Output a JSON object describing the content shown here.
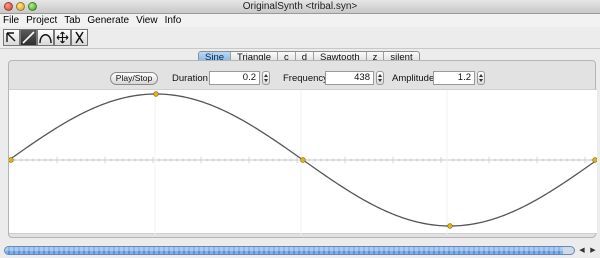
{
  "window": {
    "title": "OriginalSynth <tribal.syn>"
  },
  "menu": [
    "File",
    "Project",
    "Tab",
    "Generate",
    "View",
    "Info"
  ],
  "toolbar": {
    "tools": [
      {
        "name": "pointer-tool",
        "icon": "pointer-arrow-icon",
        "active": false
      },
      {
        "name": "line-tool",
        "icon": "diagonal-line-icon",
        "active": true
      },
      {
        "name": "curve-tool",
        "icon": "arc-curve-icon",
        "active": false
      },
      {
        "name": "move-tool",
        "icon": "four-way-arrows-icon",
        "active": false
      },
      {
        "name": "delete-tool",
        "icon": "scissor-x-icon",
        "active": false
      }
    ]
  },
  "tabs": [
    "Sine",
    "Triangle",
    "c",
    "d",
    "Sawtooth",
    "z",
    "silent"
  ],
  "selected_tab": "Sine",
  "controls": {
    "play_label": "Play/Stop",
    "duration_label": "Duration",
    "duration_value": "0.2",
    "frequency_label": "Frequency",
    "frequency_value": "438",
    "amplitude_label": "Amplitude",
    "amplitude_value": "1.2"
  },
  "waveform": {
    "type": "sine",
    "cycles": 1,
    "control_points": [
      "zero",
      "max",
      "zero",
      "min",
      "zero"
    ],
    "colors": {
      "curve": "#555555",
      "point": "#e0b020",
      "axis": "#c8c8c8"
    }
  },
  "progress": {
    "fraction": 0.98
  },
  "colors": {
    "tab_selected": "#7fb1e3",
    "progress": "#6aa0e0"
  }
}
